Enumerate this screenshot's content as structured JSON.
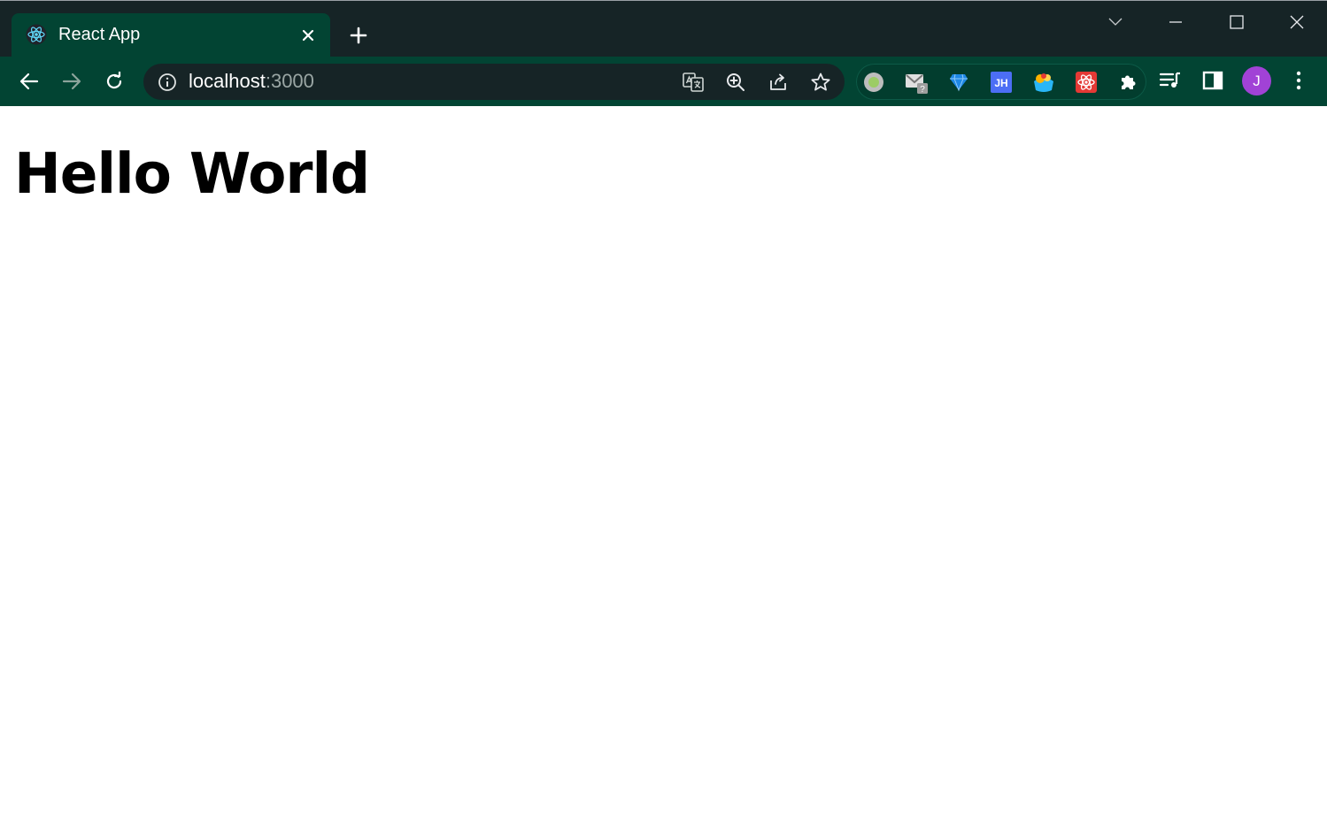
{
  "tab": {
    "title": "React App"
  },
  "address": {
    "host": "localhost",
    "port": ":3000"
  },
  "profile": {
    "initial": "J"
  },
  "content": {
    "heading": "Hello World"
  },
  "colors": {
    "frame": "#162426",
    "toolbar": "#024433",
    "avatar": "#a142d6",
    "heading": "#000000"
  },
  "icons": [
    "react-favicon-icon",
    "close-icon",
    "plus-icon",
    "chevron-down-icon",
    "minimize-icon",
    "maximize-icon",
    "close-window-icon",
    "back-arrow-icon",
    "forward-arrow-icon",
    "reload-icon",
    "info-icon",
    "translate-icon",
    "zoom-icon",
    "share-icon",
    "star-icon",
    "extension-icons",
    "puzzle-icon",
    "media-queue-icon",
    "side-panel-icon",
    "kebab-menu-icon"
  ]
}
